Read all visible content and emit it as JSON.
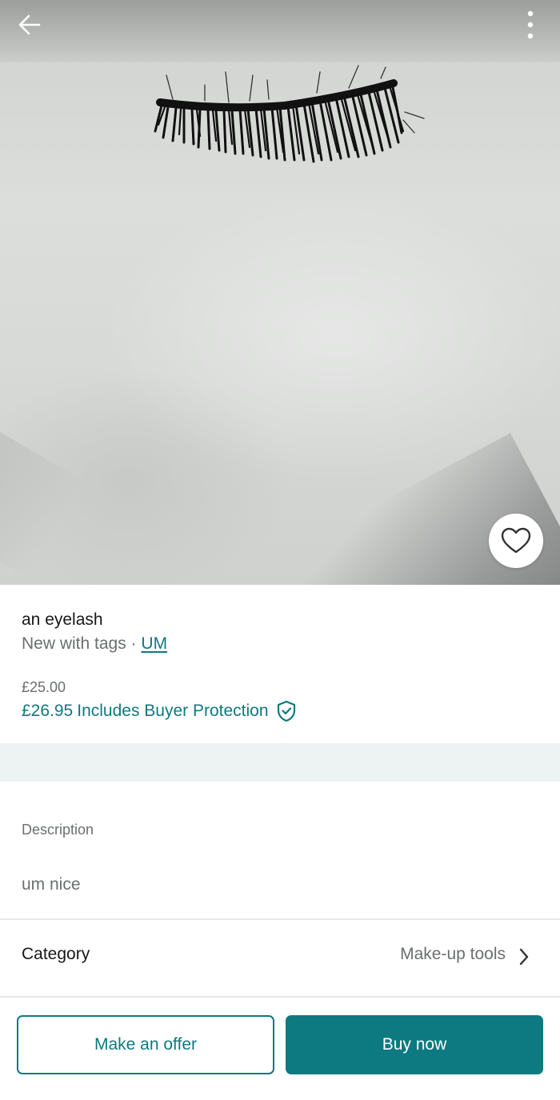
{
  "listing": {
    "title": "an eyelash",
    "condition": "New with tags",
    "separator": "·",
    "brand": "UM",
    "price": "£25.00",
    "price_total": "£26.95",
    "buyer_protection_label": "Includes Buyer Protection"
  },
  "description": {
    "label": "Description",
    "text": "um nice"
  },
  "category": {
    "label": "Category",
    "value": "Make-up tools"
  },
  "actions": {
    "offer_label": "Make an offer",
    "buy_label": "Buy now"
  },
  "icons": {
    "back": "back-arrow-icon",
    "menu": "more-vertical-icon",
    "favourite": "heart-icon",
    "protection": "shield-check-icon",
    "chevron": "chevron-right-icon"
  },
  "colors": {
    "accent": "#0c7a80",
    "muted_text": "#6b6f6f",
    "section_bg": "#edf2f2"
  }
}
